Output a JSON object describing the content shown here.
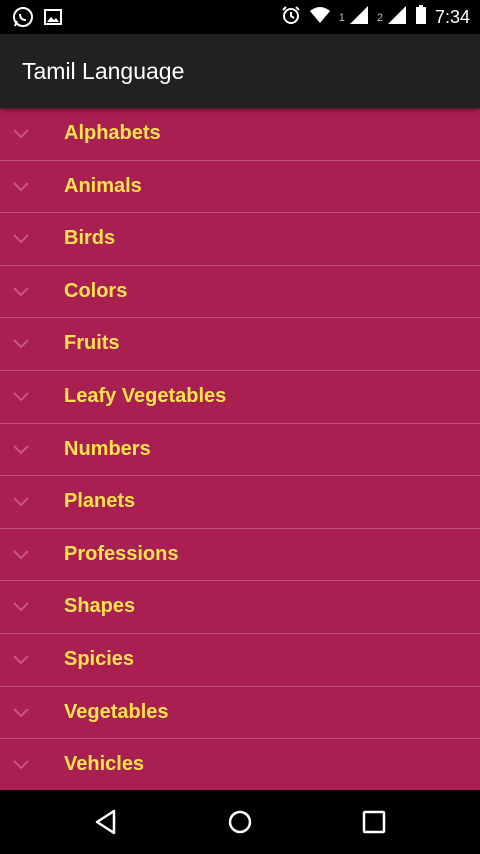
{
  "status_bar": {
    "time": "7:34",
    "sim1_label": "1",
    "sim2_label": "2",
    "icons": [
      "whatsapp-icon",
      "image-icon",
      "alarm-icon",
      "wifi-icon",
      "signal-icon",
      "battery-icon"
    ]
  },
  "app_bar": {
    "title": "Tamil Language"
  },
  "list": {
    "items": [
      {
        "label": "Alphabets"
      },
      {
        "label": "Animals"
      },
      {
        "label": "Birds"
      },
      {
        "label": "Colors"
      },
      {
        "label": "Fruits"
      },
      {
        "label": "Leafy Vegetables"
      },
      {
        "label": "Numbers"
      },
      {
        "label": "Planets"
      },
      {
        "label": "Professions"
      },
      {
        "label": "Shapes"
      },
      {
        "label": "Spicies"
      },
      {
        "label": "Vegetables"
      },
      {
        "label": "Vehicles"
      }
    ]
  },
  "colors": {
    "list_background": "#a91f52",
    "label_color": "#ffe34d",
    "app_bar": "#212121"
  },
  "nav_bar": {
    "icons": [
      "back-icon",
      "home-icon",
      "recents-icon"
    ]
  }
}
